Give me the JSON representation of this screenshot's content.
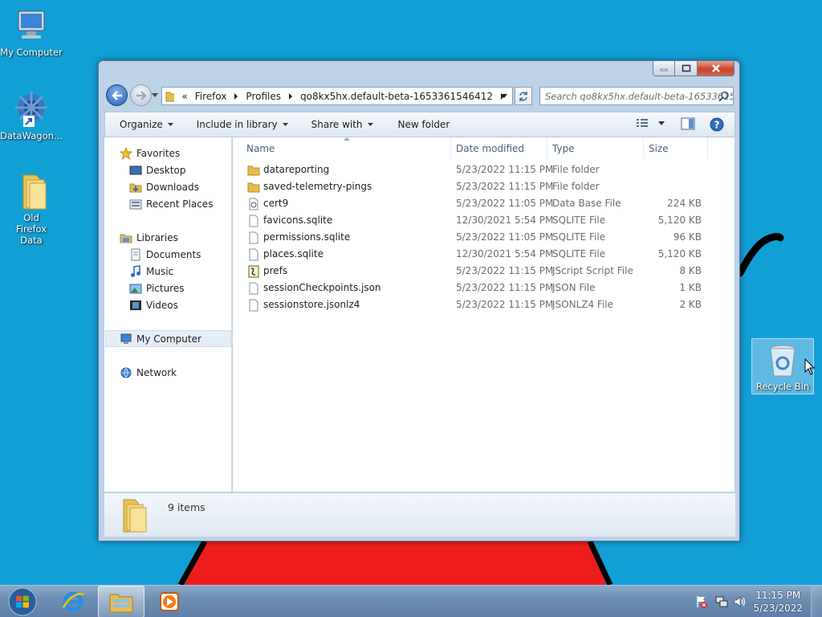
{
  "desktop": {
    "background_color": "#129fd6",
    "icons": [
      {
        "label": "My Computer",
        "icon": "computer-icon"
      },
      {
        "label": "DataWagon...",
        "icon": "shortcut-icon"
      },
      {
        "label": "Old Firefox Data",
        "icon": "folder-icon"
      },
      {
        "label": "Recycle Bin",
        "icon": "recycle-bin-icon"
      }
    ]
  },
  "window": {
    "address_segments": [
      "«",
      "Firefox",
      "Profiles",
      "qo8kx5hx.default-beta-1653361546412"
    ],
    "search_placeholder": "Search qo8kx5hx.default-beta-16533615...",
    "toolbar": {
      "organize": "Organize",
      "include_in_library": "Include in library",
      "share_with": "Share with",
      "new_folder": "New folder"
    },
    "nav": {
      "favorites": "Favorites",
      "favorites_items": [
        "Desktop",
        "Downloads",
        "Recent Places"
      ],
      "libraries": "Libraries",
      "libraries_items": [
        "Documents",
        "Music",
        "Pictures",
        "Videos"
      ],
      "computer": "My Computer",
      "network": "Network"
    },
    "columns": {
      "name": "Name",
      "date": "Date modified",
      "type": "Type",
      "size": "Size"
    },
    "files": [
      {
        "name": "datareporting",
        "date": "5/23/2022 11:15 PM",
        "type": "File folder",
        "size": "",
        "icon": "folder"
      },
      {
        "name": "saved-telemetry-pings",
        "date": "5/23/2022 11:15 PM",
        "type": "File folder",
        "size": "",
        "icon": "folder"
      },
      {
        "name": "cert9",
        "date": "5/23/2022 11:05 PM",
        "type": "Data Base File",
        "size": "224 KB",
        "icon": "db"
      },
      {
        "name": "favicons.sqlite",
        "date": "12/30/2021 5:54 PM",
        "type": "SQLITE File",
        "size": "5,120 KB",
        "icon": "file"
      },
      {
        "name": "permissions.sqlite",
        "date": "5/23/2022 11:05 PM",
        "type": "SQLITE File",
        "size": "96 KB",
        "icon": "file"
      },
      {
        "name": "places.sqlite",
        "date": "12/30/2021 5:54 PM",
        "type": "SQLITE File",
        "size": "5,120 KB",
        "icon": "file"
      },
      {
        "name": "prefs",
        "date": "5/23/2022 11:15 PM",
        "type": "JScript Script File",
        "size": "8 KB",
        "icon": "script"
      },
      {
        "name": "sessionCheckpoints.json",
        "date": "5/23/2022 11:15 PM",
        "type": "JSON File",
        "size": "1 KB",
        "icon": "file"
      },
      {
        "name": "sessionstore.jsonlz4",
        "date": "5/23/2022 11:15 PM",
        "type": "JSONLZ4 File",
        "size": "2 KB",
        "icon": "file"
      }
    ],
    "item_count": "9 items"
  },
  "taskbar": {
    "time": "11:15 PM",
    "date": "5/23/2022"
  }
}
